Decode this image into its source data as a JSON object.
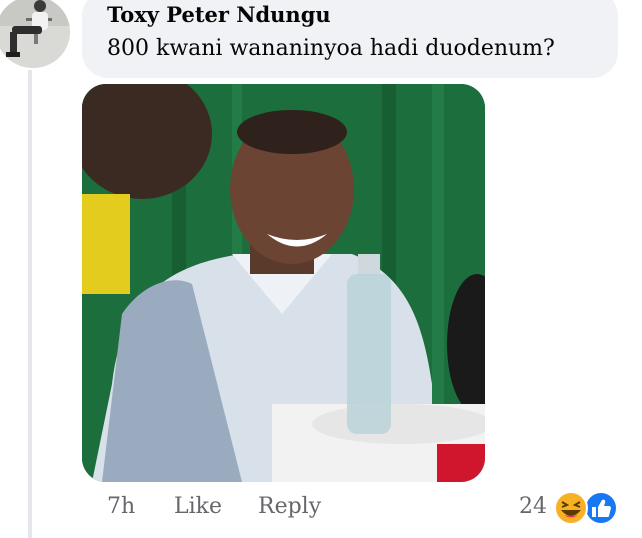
{
  "comment": {
    "author": "Toxy Peter Ndungu",
    "text": "800 kwani wananinyoa hadi duodenum?",
    "time": "7h",
    "like_label": "Like",
    "reply_label": "Reply",
    "reaction_count": "24",
    "reactions": [
      "haha-icon",
      "like-icon"
    ]
  },
  "colors": {
    "bubble_bg": "#f0f2f5",
    "meta_text": "#65676b",
    "like_blue": "#1877f2",
    "haha_yellow": "#f7b125",
    "thread_line": "#e4e6eb"
  }
}
